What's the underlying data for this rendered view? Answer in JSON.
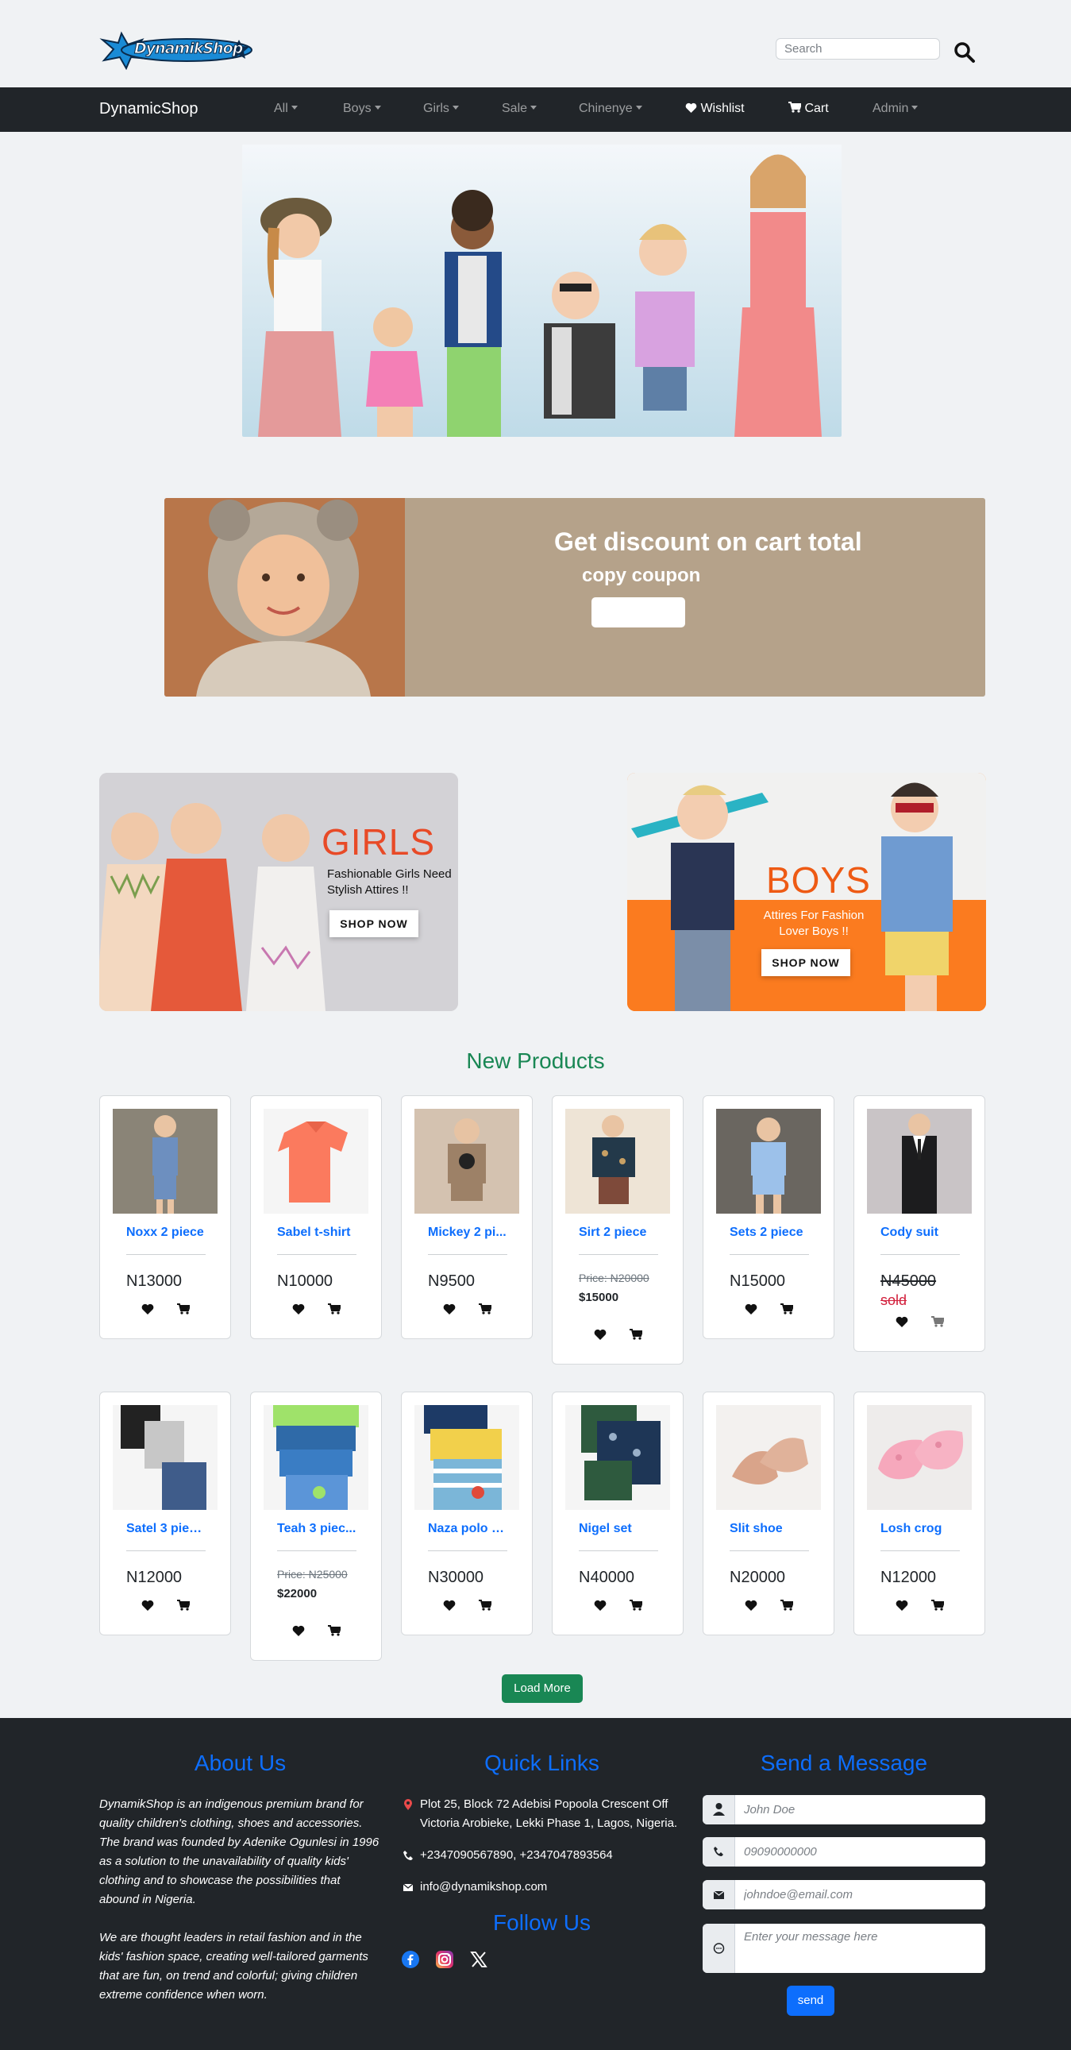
{
  "header": {
    "logo_text": "DynamikShop",
    "search_placeholder": "Search"
  },
  "nav": {
    "brand": "DynamicShop",
    "items": [
      {
        "label": "All",
        "dropdown": true
      },
      {
        "label": "Boys",
        "dropdown": true
      },
      {
        "label": "Girls",
        "dropdown": true
      },
      {
        "label": "Sale",
        "dropdown": true
      },
      {
        "label": "Chinenye",
        "dropdown": true
      },
      {
        "label": "Wishlist",
        "icon": "heart-icon"
      },
      {
        "label": "Cart",
        "icon": "cart-icon"
      },
      {
        "label": "Admin",
        "dropdown": true
      }
    ]
  },
  "discount": {
    "title": "Get discount on cart total",
    "subtitle": "copy coupon",
    "button_label": ""
  },
  "promos": {
    "girls": {
      "title": "GIRLS",
      "subtitle": "Fashionable Girls Need Stylish Attires !!",
      "button": "SHOP NOW"
    },
    "boys": {
      "title": "BOYS",
      "subtitle": "Attires For Fashion Lover Boys !!",
      "button": "SHOP NOW"
    }
  },
  "products_section": {
    "title": "New Products",
    "load_more": "Load More",
    "row1": [
      {
        "name": "Noxx 2 piece",
        "price": "N13000"
      },
      {
        "name": "Sabel t-shirt",
        "price": "N10000"
      },
      {
        "name": "Mickey 2 pi...",
        "price": "N9500"
      },
      {
        "name": "Sirt 2 piece",
        "old_price": "Price: N20000",
        "new_price": "$15000"
      },
      {
        "name": "Sets 2 piece",
        "price": "N15000"
      },
      {
        "name": "Cody suit",
        "price": "N45000",
        "sold": "sold"
      }
    ],
    "row2": [
      {
        "name": "Satel 3 piec...",
        "price": "N12000"
      },
      {
        "name": "Teah 3 piec...",
        "old_price": "Price: N25000",
        "new_price": "$22000"
      },
      {
        "name": "Naza polo s...",
        "price": "N30000"
      },
      {
        "name": "Nigel set",
        "price": "N40000"
      },
      {
        "name": "Slit shoe",
        "price": "N20000"
      },
      {
        "name": "Losh crog",
        "price": "N12000"
      }
    ]
  },
  "footer": {
    "about_title": "About Us",
    "about_p1": "DynamikShop is an indigenous premium brand for quality children's clothing, shoes and accessories. The brand was founded by Adenike Ogunlesi in 1996 as a solution to the unavailability of quality kids' clothing and to showcase the possibilities that abound in Nigeria.",
    "about_p2": "We are thought leaders in retail fashion and in the kids' fashion space, creating well-tailored garments that are fun, on trend and colorful; giving children extreme confidence when worn.",
    "links_title": "Quick Links",
    "address": "Plot 25, Block 72 Adebisi Popoola Crescent Off Victoria Arobieke, Lekki Phase 1, Lagos, Nigeria.",
    "phone": "+2347090567890, +2347047893564",
    "email": "info@dynamikshop.com",
    "follow_title": "Follow Us",
    "message_title": "Send a Message",
    "name_placeholder": "John Doe",
    "phone_placeholder": "09090000000",
    "email_placeholder": "johndoe@email.com",
    "message_placeholder": "Enter your message here",
    "send_label": "send"
  },
  "colors": {
    "primary": "#0d6efd",
    "success": "#198754",
    "dark": "#212529",
    "discount_bg": "#b5a28a",
    "boys_orange": "#fb7b1f",
    "girls_red": "#e84a27"
  }
}
